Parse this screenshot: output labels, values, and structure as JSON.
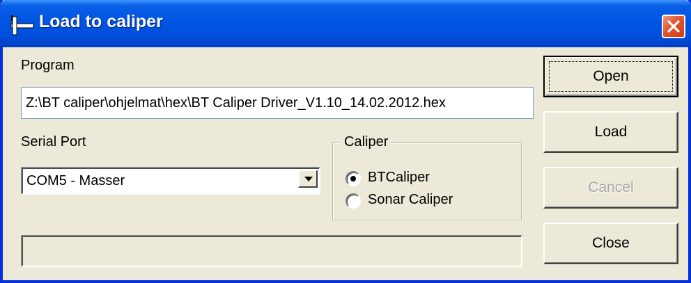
{
  "window": {
    "title": "Load to caliper",
    "app_icon": "caliper-icon",
    "close_icon": "close-icon"
  },
  "program": {
    "label": "Program",
    "path": "Z:\\BT caliper\\ohjelmat\\hex\\BT Caliper Driver_V1.10_14.02.2012.hex"
  },
  "serial_port": {
    "label": "Serial Port",
    "selected": "COM5 - Masser"
  },
  "caliper": {
    "legend": "Caliper",
    "options": [
      {
        "label": "BTCaliper",
        "checked": true
      },
      {
        "label": "Sonar Caliper",
        "checked": false
      }
    ]
  },
  "progress": {
    "value": 0
  },
  "buttons": {
    "open": "Open",
    "load": "Load",
    "cancel": "Cancel",
    "close": "Close"
  },
  "colors": {
    "titlebar": "#0054e3",
    "face": "#ece9d8",
    "close_red": "#e45a33"
  }
}
